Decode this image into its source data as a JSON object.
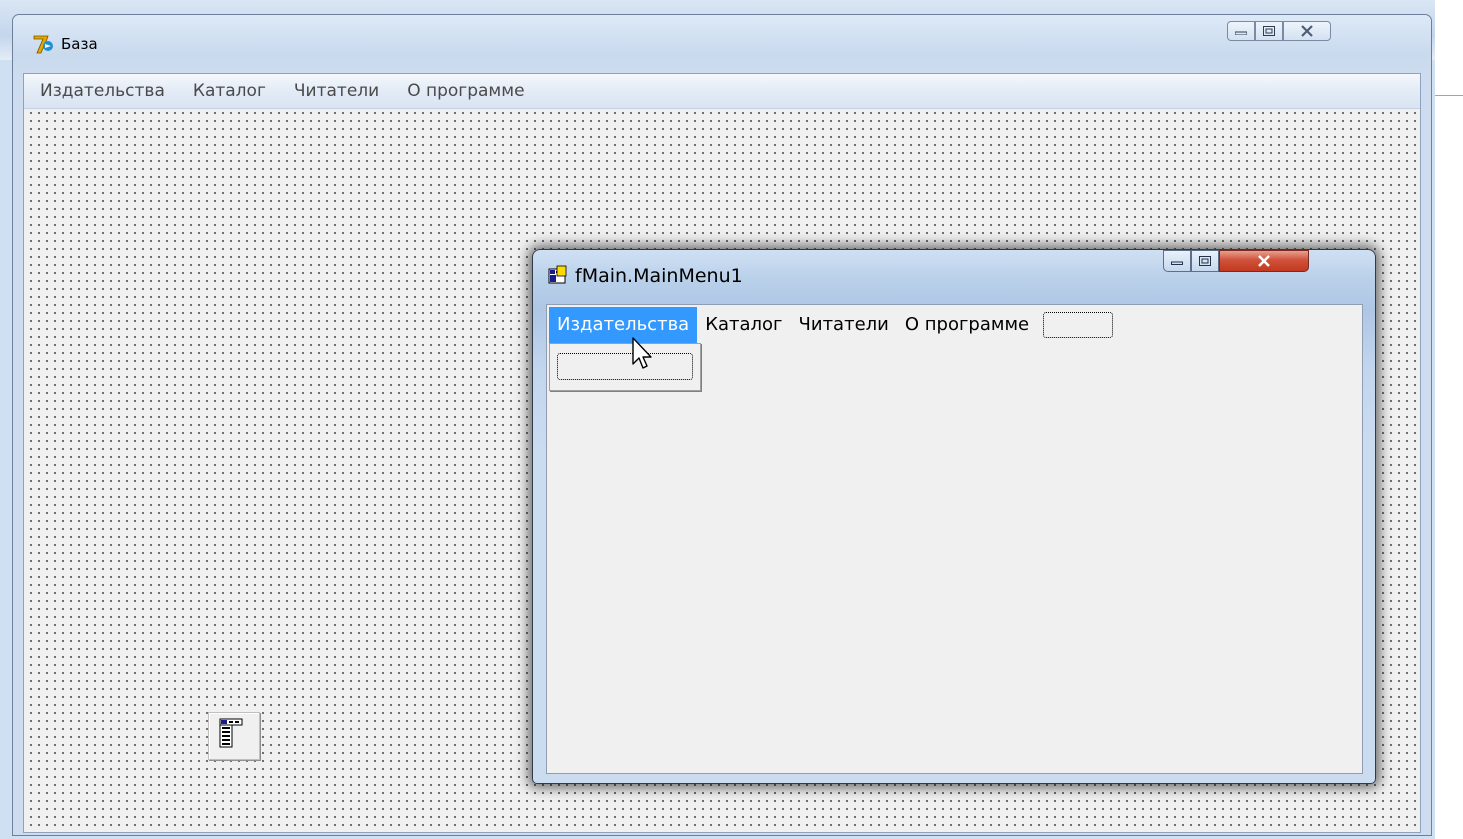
{
  "main_window": {
    "title": "База",
    "menu": [
      "Издательства",
      "Каталог",
      "Читатели",
      "О программе"
    ],
    "caption_buttons": [
      "minimize-icon",
      "maximize-icon",
      "close-icon"
    ],
    "component_icon": "main-menu-component-icon"
  },
  "menu_designer": {
    "title": "fMain.MainMenu1",
    "menu": [
      "Издательства",
      "Каталог",
      "Читатели",
      "О программе"
    ],
    "active_item": "Издательства",
    "caption_buttons": [
      "minimize-icon",
      "maximize-icon",
      "close-icon"
    ]
  },
  "colors": {
    "highlight": "#3399ff",
    "close_button": "#c2381f",
    "form_background": "#f0f0f0"
  }
}
